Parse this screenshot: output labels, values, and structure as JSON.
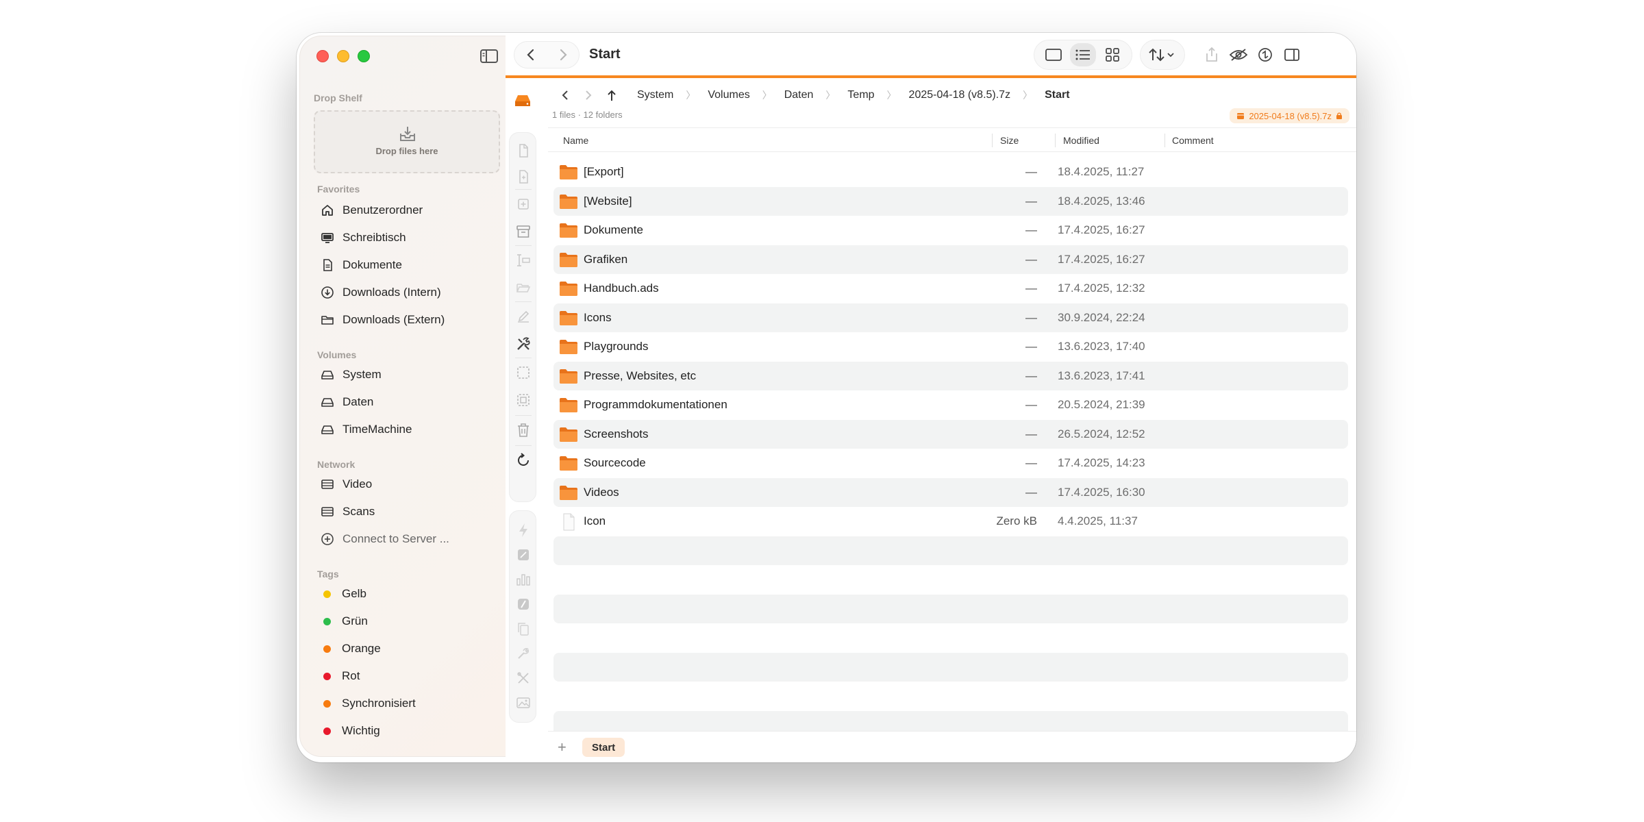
{
  "window": {
    "title": "Start",
    "accent_color": "#f7871f"
  },
  "sidebar": {
    "drop_shelf": {
      "title": "Drop Shelf",
      "label": "Drop files here"
    },
    "favorites": {
      "title": "Favorites",
      "items": [
        {
          "label": "Benutzerordner",
          "icon": "home-icon"
        },
        {
          "label": "Schreibtisch",
          "icon": "desktop-icon"
        },
        {
          "label": "Dokumente",
          "icon": "document-icon"
        },
        {
          "label": "Downloads (Intern)",
          "icon": "download-circle-icon"
        },
        {
          "label": "Downloads (Extern)",
          "icon": "folder-icon"
        }
      ]
    },
    "volumes": {
      "title": "Volumes",
      "items": [
        {
          "label": "System",
          "icon": "drive-icon"
        },
        {
          "label": "Daten",
          "icon": "drive-icon"
        },
        {
          "label": "TimeMachine",
          "icon": "drive-icon"
        }
      ]
    },
    "network": {
      "title": "Network",
      "items": [
        {
          "label": "Video",
          "icon": "server-icon"
        },
        {
          "label": "Scans",
          "icon": "server-icon"
        },
        {
          "label": "Connect to Server ...",
          "icon": "plus-circle-icon"
        }
      ]
    },
    "tags": {
      "title": "Tags",
      "items": [
        {
          "label": "Gelb",
          "color": "#f5c400"
        },
        {
          "label": "Grün",
          "color": "#2dbd4c"
        },
        {
          "label": "Orange",
          "color": "#f77b0f"
        },
        {
          "label": "Rot",
          "color": "#e8192c"
        },
        {
          "label": "Synchronisiert",
          "color": "#f77b0f"
        },
        {
          "label": "Wichtig",
          "color": "#e8192c"
        }
      ]
    }
  },
  "breadcrumb": {
    "items": [
      "System",
      "Volumes",
      "Daten",
      "Temp",
      "2025-04-18 (v8.5).7z",
      "Start"
    ]
  },
  "summary": "1 files · 12 folders",
  "archive_badge": "2025-04-18 (v8.5).7z",
  "table": {
    "columns": {
      "name": "Name",
      "size": "Size",
      "modified": "Modified",
      "comment": "Comment"
    },
    "rows": [
      {
        "name": "[Export]",
        "size": "—",
        "modified": "18.4.2025, 11:27",
        "type": "folder"
      },
      {
        "name": "[Website]",
        "size": "—",
        "modified": "18.4.2025, 13:46",
        "type": "folder"
      },
      {
        "name": "Dokumente",
        "size": "—",
        "modified": "17.4.2025, 16:27",
        "type": "folder"
      },
      {
        "name": "Grafiken",
        "size": "—",
        "modified": "17.4.2025, 16:27",
        "type": "folder"
      },
      {
        "name": "Handbuch.ads",
        "size": "—",
        "modified": "17.4.2025, 12:32",
        "type": "folder"
      },
      {
        "name": "Icons",
        "size": "—",
        "modified": "30.9.2024, 22:24",
        "type": "folder"
      },
      {
        "name": "Playgrounds",
        "size": "—",
        "modified": "13.6.2023, 17:40",
        "type": "folder"
      },
      {
        "name": "Presse, Websites, etc",
        "size": "—",
        "modified": "13.6.2023, 17:41",
        "type": "folder"
      },
      {
        "name": "Programmdokumentationen",
        "size": "—",
        "modified": "20.5.2024, 21:39",
        "type": "folder"
      },
      {
        "name": "Screenshots",
        "size": "—",
        "modified": "26.5.2024, 12:52",
        "type": "folder"
      },
      {
        "name": "Sourcecode",
        "size": "—",
        "modified": "17.4.2025, 14:23",
        "type": "folder"
      },
      {
        "name": "Videos",
        "size": "—",
        "modified": "17.4.2025, 16:30",
        "type": "folder"
      },
      {
        "name": "Icon",
        "size": "Zero kB",
        "modified": "4.4.2025, 11:37",
        "type": "file"
      }
    ]
  },
  "bottom_tab": "Start"
}
